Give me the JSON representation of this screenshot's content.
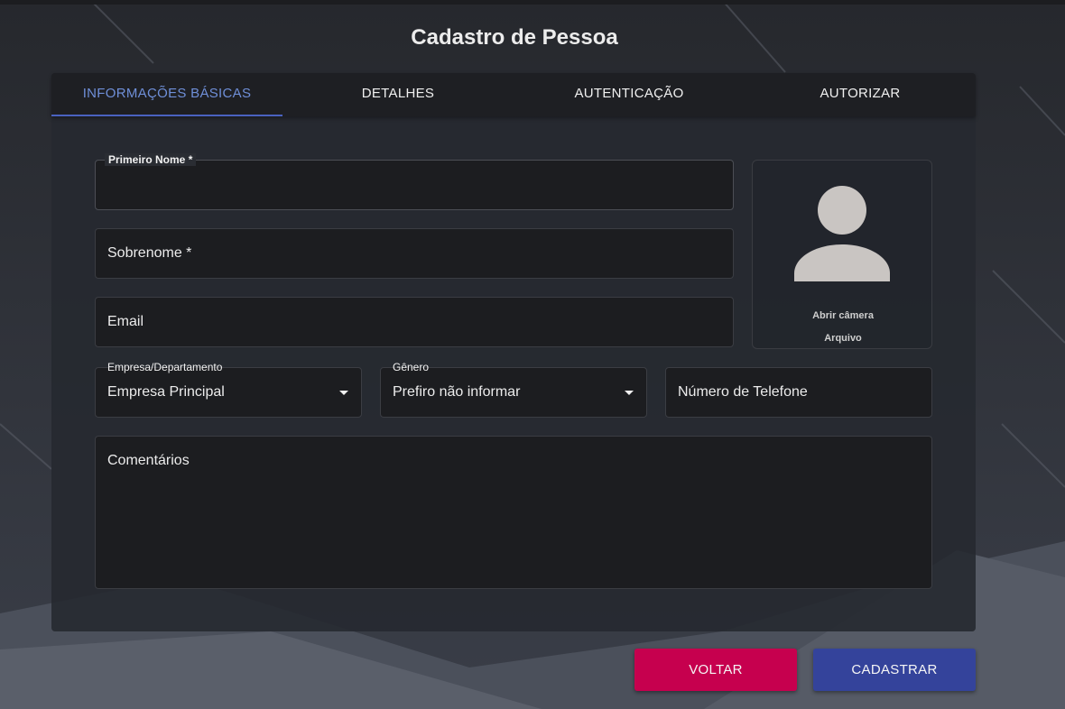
{
  "page": {
    "title": "Cadastro de Pessoa"
  },
  "tabs": [
    {
      "label": "INFORMAÇÕES BÁSICAS",
      "active": true
    },
    {
      "label": "DETALHES",
      "active": false
    },
    {
      "label": "AUTENTICAÇÃO",
      "active": false
    },
    {
      "label": "AUTORIZAR",
      "active": false
    }
  ],
  "form": {
    "first_name": {
      "label": "Primeiro Nome *",
      "value": ""
    },
    "last_name": {
      "placeholder": "Sobrenome *",
      "value": ""
    },
    "email": {
      "placeholder": "Email",
      "value": ""
    },
    "company": {
      "label": "Empresa/Departamento",
      "value": "Empresa Principal"
    },
    "gender": {
      "label": "Gênero",
      "value": "Prefiro não informar"
    },
    "phone": {
      "placeholder": "Número de Telefone",
      "value": ""
    },
    "comments": {
      "placeholder": "Comentários",
      "value": ""
    }
  },
  "photo": {
    "icon": "avatar-placeholder-icon",
    "open_camera": "Abrir câmera",
    "file": "Arquivo"
  },
  "actions": {
    "back": "VOLTAR",
    "submit": "CADASTRAR"
  },
  "colors": {
    "accent": "#6f8fd8",
    "tab_indicator": "#4a62c0",
    "back_button": "#c6004e",
    "submit_button": "#34439b",
    "field_bg": "#1c1d20"
  }
}
